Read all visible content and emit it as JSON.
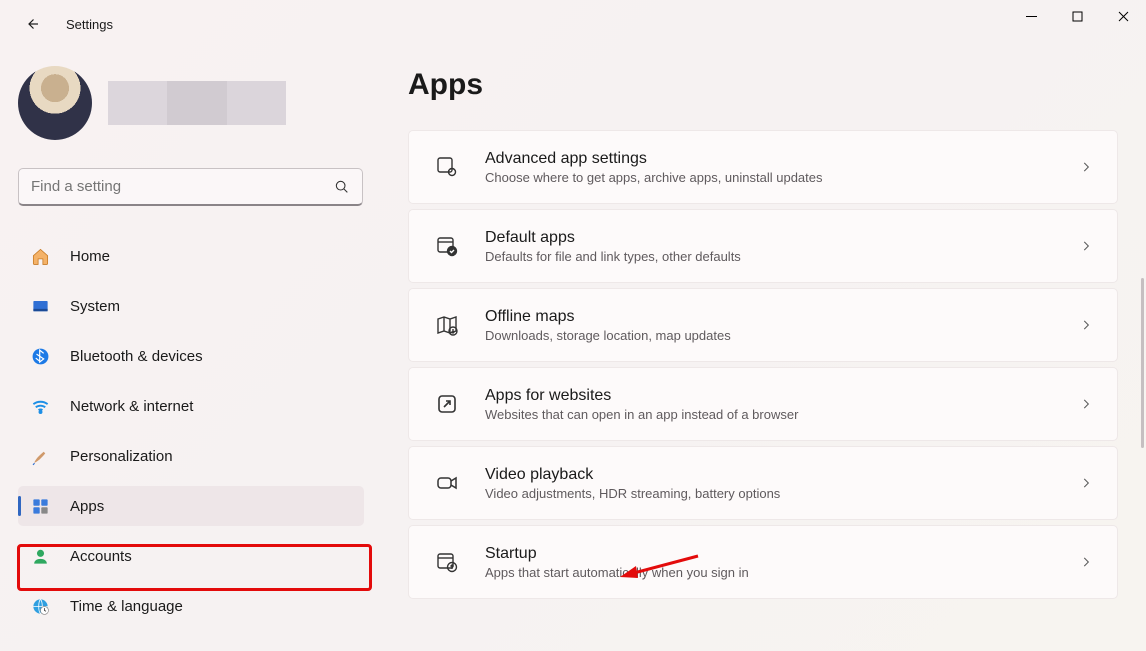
{
  "window": {
    "title": "Settings"
  },
  "search": {
    "placeholder": "Find a setting"
  },
  "sidebar": {
    "items": [
      {
        "label": "Home"
      },
      {
        "label": "System"
      },
      {
        "label": "Bluetooth & devices"
      },
      {
        "label": "Network & internet"
      },
      {
        "label": "Personalization"
      },
      {
        "label": "Apps"
      },
      {
        "label": "Accounts"
      },
      {
        "label": "Time & language"
      }
    ]
  },
  "page": {
    "title": "Apps"
  },
  "cards": [
    {
      "title": "Advanced app settings",
      "sub": "Choose where to get apps, archive apps, uninstall updates"
    },
    {
      "title": "Default apps",
      "sub": "Defaults for file and link types, other defaults"
    },
    {
      "title": "Offline maps",
      "sub": "Downloads, storage location, map updates"
    },
    {
      "title": "Apps for websites",
      "sub": "Websites that can open in an app instead of a browser"
    },
    {
      "title": "Video playback",
      "sub": "Video adjustments, HDR streaming, battery options"
    },
    {
      "title": "Startup",
      "sub": "Apps that start automatically when you sign in"
    }
  ]
}
